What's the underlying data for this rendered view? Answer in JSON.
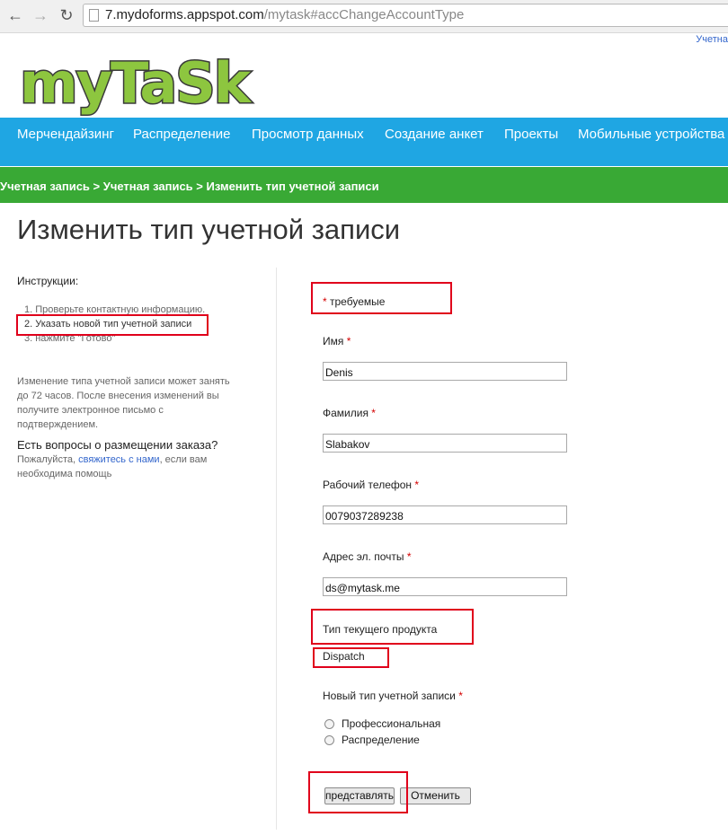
{
  "browser": {
    "url_host": "7.mydoforms.appspot.com",
    "url_path": "/mytask#accChangeAccountType"
  },
  "header": {
    "top_link": "Учетна",
    "logo_text": "myTaSk",
    "logo_color": "#8dc63f"
  },
  "nav": {
    "items": [
      "Мерчендайзинг",
      "Распределение",
      "Просмотр данных",
      "Создание анкет",
      "Проекты",
      "Мобильные устройства"
    ],
    "color": "#1fa6e3"
  },
  "breadcrumb": {
    "text": "Учетная запись > Учетная запись > Изменить тип учетной записи",
    "color": "#39a935"
  },
  "page": {
    "title": "Изменить тип учетной записи"
  },
  "sidebar": {
    "instructions_label": "Инструкции:",
    "steps": [
      "1.  Проверьте контактную информацию.",
      "2.  Указать новой тип учетной записи",
      "3.  нажмите \"Готово\""
    ],
    "note": "Изменение типа учетной записи может занять до 72 часов. После внесения изменений вы получите электронное письмо с подтверждением.",
    "questions_heading": "Есть вопросы о размещении заказа?",
    "help_prefix": "Пожалуйста,",
    "help_link": "свяжитесь с нами",
    "help_suffix": ", если вам необходима помощь"
  },
  "form": {
    "required_note": "требуемые",
    "first_name_label": "Имя",
    "first_name_value": "Denis",
    "last_name_label": "Фамилия",
    "last_name_value": "Slabakov",
    "phone_label": "Рабочий телефон",
    "phone_value": "0079037289238",
    "email_label": "Адрес эл. почты",
    "email_value": "ds@mytask.me",
    "current_product_label": "Тип текущего продукта",
    "current_product_value": "Dispatch",
    "new_type_label": "Новый тип учетной записи",
    "options": [
      "Профессиональная",
      "Распределение"
    ],
    "submit_label": "представлять",
    "cancel_label": "Отменить",
    "asterisk": "*"
  }
}
